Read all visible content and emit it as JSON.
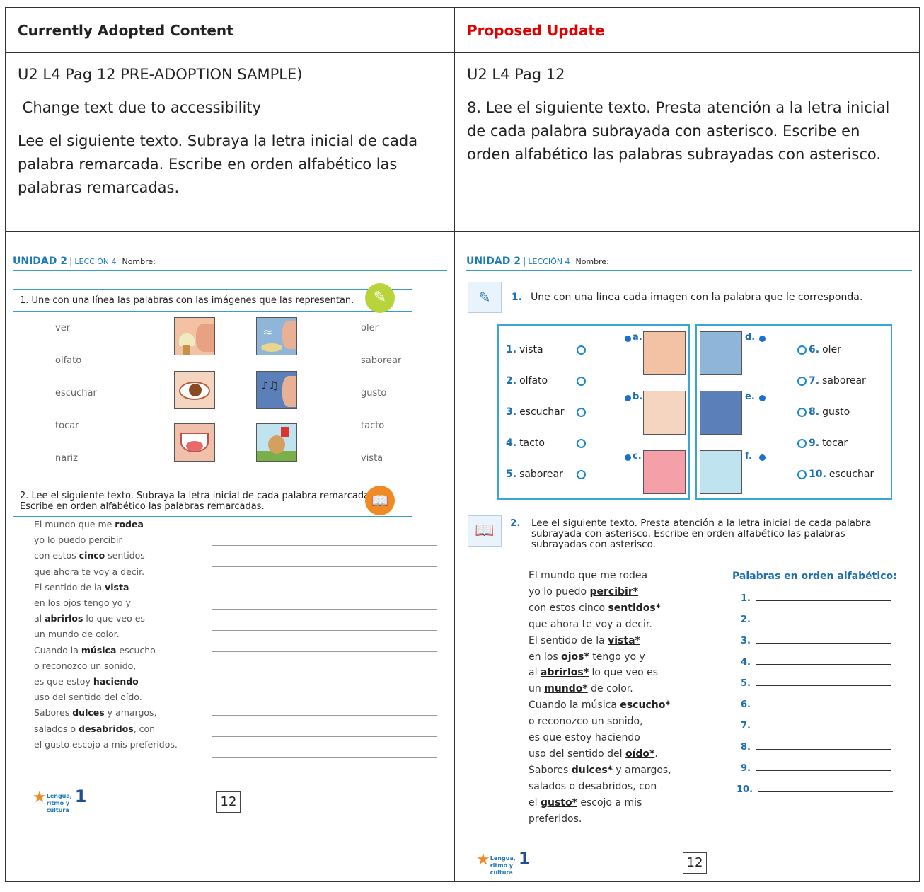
{
  "headers": {
    "left": "Currently Adopted Content",
    "right": "Proposed Update"
  },
  "left_desc": {
    "line1": "U2 L4 Pag 12   PRE-ADOPTION SAMPLE)",
    "line2": " Change text due to accessibility",
    "line3": "Lee el siguiente texto. Subraya la letra inicial de cada palabra remarcada. Escribe en orden alfabético las palabras remarcadas."
  },
  "right_desc": {
    "line1": "U2 L4  Pag 12",
    "line2": "8. Lee el siguiente texto. Presta atención a la letra inicial de cada palabra subrayada con asterisco. Escribe en orden alfabético las palabras subrayadas con asterisco."
  },
  "ws_left": {
    "unidad": "UNIDAD 2",
    "leccion": "LECCIÓN 4",
    "nombre": "Nombre:",
    "q1": "1. Une con una línea las palabras con las imágenes que las representan.",
    "words_left": [
      "ver",
      "olfato",
      "escuchar",
      "tocar",
      "nariz"
    ],
    "words_right": [
      "oler",
      "saborear",
      "gusto",
      "tacto",
      "vista"
    ],
    "q2_line1": "2. Lee el siguiente texto. Subraya la letra inicial de cada palabra remarcada.",
    "q2_line2": "Escribe en orden alfabético las palabras remarcadas.",
    "poem": [
      [
        "El mundo que me ",
        "rodea",
        ""
      ],
      [
        "yo lo puedo percibir",
        "",
        ""
      ],
      [
        "con estos ",
        "cinco",
        " sentidos"
      ],
      [
        "que ahora te voy a decir.",
        "",
        ""
      ],
      [
        "El sentido de la ",
        "vista",
        ""
      ],
      [
        "en los ojos tengo yo y",
        "",
        ""
      ],
      [
        "al ",
        "abrirlos",
        " lo que veo es"
      ],
      [
        "un mundo de color.",
        "",
        ""
      ],
      [
        "Cuando la ",
        "música",
        " escucho"
      ],
      [
        "o reconozco un sonido,",
        "",
        ""
      ],
      [
        "es que estoy ",
        "haciendo",
        ""
      ],
      [
        "uso del sentido del oído.",
        "",
        ""
      ],
      [
        "Sabores ",
        "dulces",
        " y amargos,"
      ],
      [
        "salados o ",
        "desabridos",
        ", con"
      ],
      [
        "el gusto escojo a mis preferidos.",
        "",
        ""
      ]
    ],
    "page": "12",
    "logo": "Lengua, ritmo y cultura",
    "logo_num": "1"
  },
  "ws_right": {
    "unidad": "UNIDAD 2",
    "leccion": "LECCIÓN 4",
    "nombre": "Nombre:",
    "q1_num": "1.",
    "q1": "Une con una línea cada imagen con la palabra que le corresponda.",
    "left_opts": [
      {
        "n": "1.",
        "w": "vista"
      },
      {
        "n": "2.",
        "w": "olfato"
      },
      {
        "n": "3.",
        "w": "escuchar"
      },
      {
        "n": "4.",
        "w": "tacto"
      },
      {
        "n": "5.",
        "w": "saborear"
      }
    ],
    "right_opts": [
      {
        "n": "6.",
        "w": "oler"
      },
      {
        "n": "7.",
        "w": "saborear"
      },
      {
        "n": "8.",
        "w": "gusto"
      },
      {
        "n": "9.",
        "w": "tocar"
      },
      {
        "n": "10.",
        "w": "escuchar"
      }
    ],
    "pic_labels_left": [
      "a.",
      "b.",
      "c."
    ],
    "pic_labels_right": [
      "d.",
      "e.",
      "f."
    ],
    "q2_num": "2.",
    "q2": "Lee el siguiente texto. Presta atención a la letra inicial de cada palabra subrayada con asterisco. Escribe en orden alfabético las palabras subrayadas con asterisco.",
    "answers_title": "Palabras en orden alfabético:",
    "answer_nums": [
      "1.",
      "2.",
      "3.",
      "4.",
      "5.",
      "6.",
      "7.",
      "8.",
      "9.",
      "10."
    ],
    "poem": [
      [
        "El mundo que me rodea",
        "",
        ""
      ],
      [
        "yo lo puedo ",
        "percibir*",
        ""
      ],
      [
        "con estos cinco ",
        "sentidos*",
        ""
      ],
      [
        "que ahora te voy a decir.",
        "",
        ""
      ],
      [
        "El sentido de la ",
        "vista*",
        ""
      ],
      [
        "en los ",
        "ojos*",
        " tengo yo y"
      ],
      [
        "al ",
        "abrirlos*",
        " lo que veo es"
      ],
      [
        "un ",
        "mundo*",
        " de color."
      ],
      [
        "Cuando la música ",
        "escucho*",
        ""
      ],
      [
        "o reconozco un sonido,",
        "",
        ""
      ],
      [
        "es que estoy haciendo",
        "",
        ""
      ],
      [
        "uso del sentido del ",
        "oído*",
        "."
      ],
      [
        "Sabores ",
        "dulces*",
        " y amargos,"
      ],
      [
        "salados o desabridos, con",
        "",
        ""
      ],
      [
        "el ",
        "gusto*",
        " escojo a mis"
      ],
      [
        "preferidos.",
        "",
        ""
      ]
    ],
    "page": "12",
    "logo": "Lengua, ritmo y cultura",
    "logo_num": "1"
  }
}
